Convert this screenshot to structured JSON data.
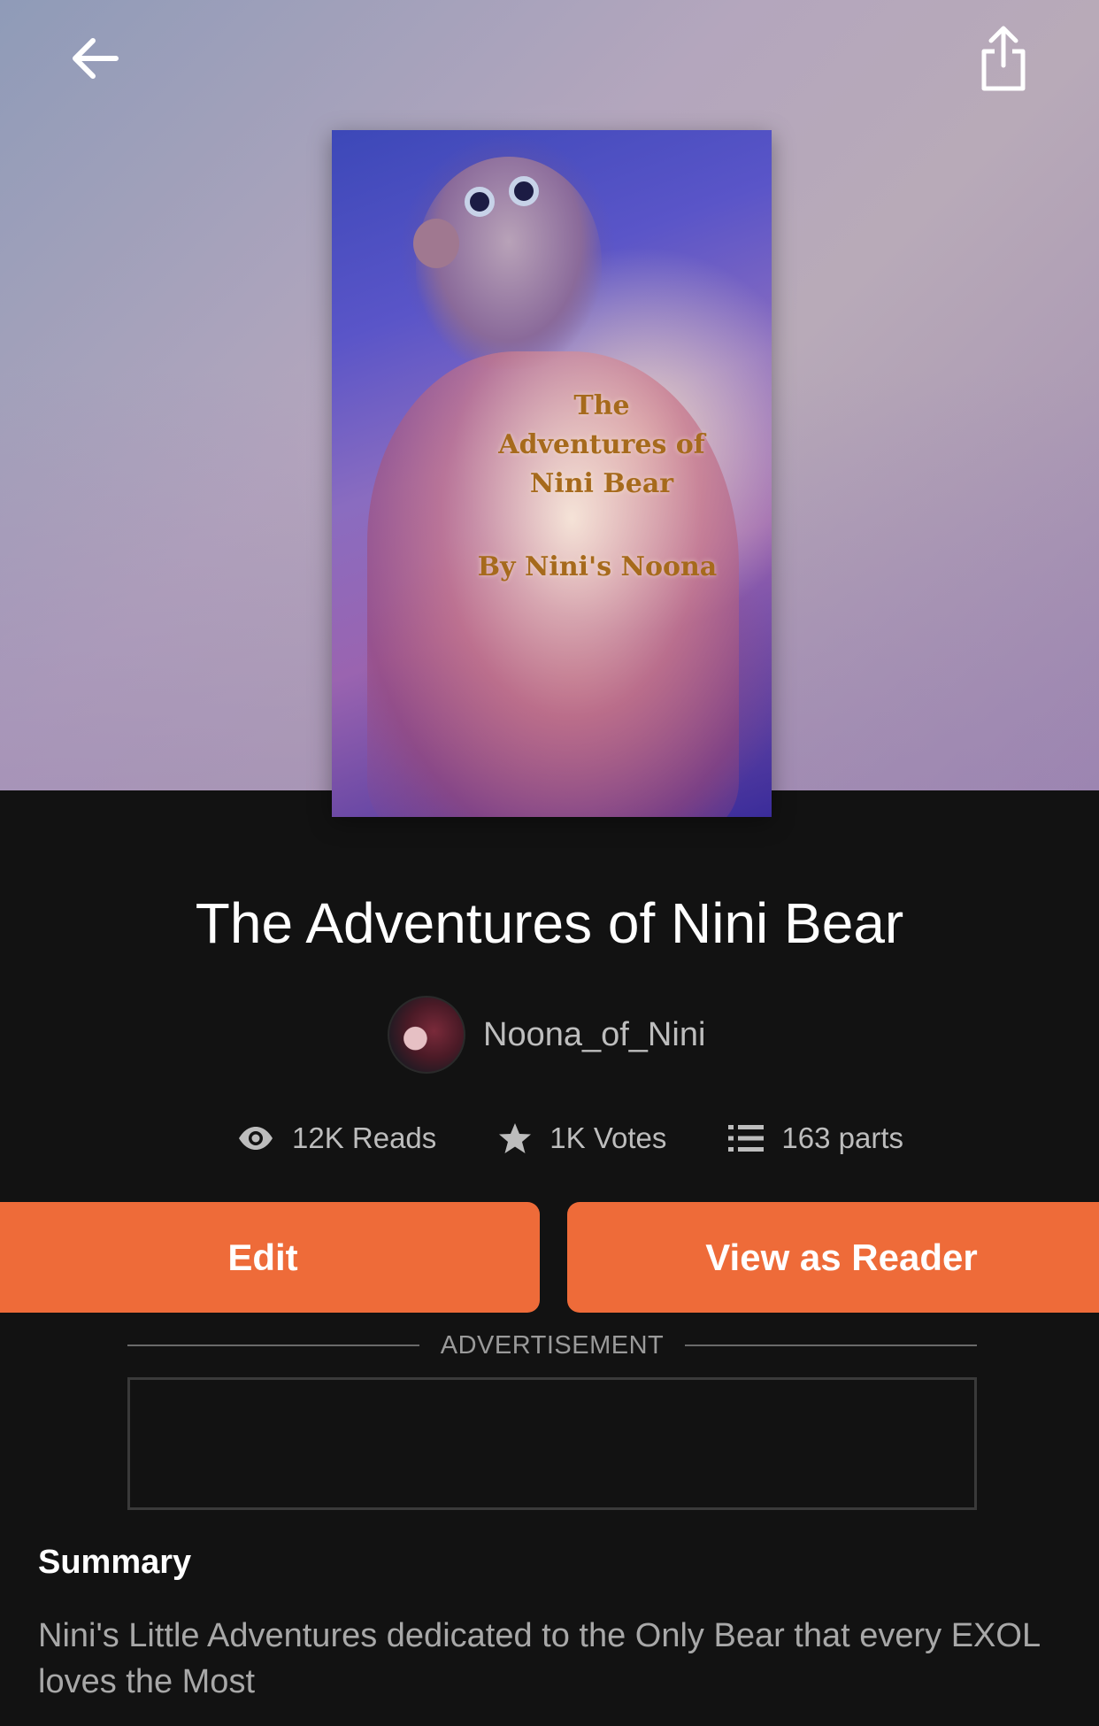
{
  "header": {
    "back_icon": "arrow-left-icon",
    "share_icon": "share-icon"
  },
  "cover": {
    "title_text": "The Adventures of Nini Bear",
    "author_text": "By Nini's Noona"
  },
  "story": {
    "title": "The Adventures of Nini Bear",
    "author": "Noona_of_Nini"
  },
  "stats": {
    "reads": "12K Reads",
    "votes": "1K Votes",
    "parts": "163 parts"
  },
  "actions": {
    "edit_label": "Edit",
    "view_as_reader_label": "View as Reader"
  },
  "ad": {
    "label": "ADVERTISEMENT"
  },
  "summary": {
    "heading": "Summary",
    "text": "Nini's Little Adventures dedicated to the Only Bear that every EXOL loves the Most"
  },
  "colors": {
    "accent": "#ee6b39",
    "background": "#121212",
    "muted_text": "#bdbdbd"
  }
}
